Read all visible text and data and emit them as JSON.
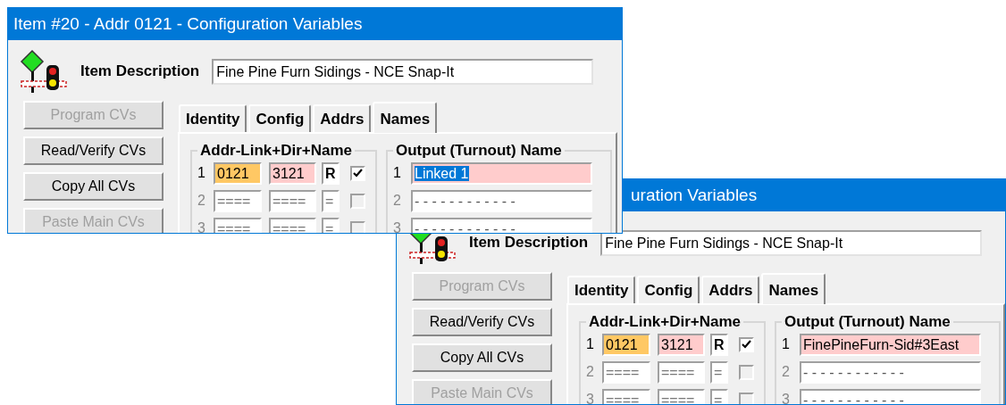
{
  "windows": [
    {
      "title": "Item #20 - Addr 0121 - Configuration Variables",
      "description_label": "Item Description",
      "description": "Fine Pine Furn Sidings - NCE Snap-It",
      "buttons": [
        {
          "label": "Program CVs",
          "disabled": true
        },
        {
          "label": "Read/Verify CVs",
          "disabled": false
        },
        {
          "label": "Copy All CVs",
          "disabled": false
        },
        {
          "label": "Paste Main CVs",
          "disabled": true
        }
      ],
      "tabs": [
        {
          "label": "Identity",
          "selected": false
        },
        {
          "label": "Config",
          "selected": false
        },
        {
          "label": "Addrs",
          "selected": false
        },
        {
          "label": "Names",
          "selected": true
        }
      ],
      "addr_group": {
        "title": "Addr-Link+Dir+Name",
        "rows": [
          {
            "number": "1",
            "addr": "0121",
            "link": "3121",
            "dir": "R",
            "active": true,
            "checked": true
          },
          {
            "number": "2",
            "addr": "====",
            "link": "====",
            "dir": "=",
            "active": false,
            "checked": false
          },
          {
            "number": "3",
            "addr": "====",
            "link": "====",
            "dir": "=",
            "active": false,
            "checked": false
          }
        ]
      },
      "name_group": {
        "title": "Output (Turnout) Name",
        "rows": [
          {
            "number": "1",
            "name": "Linked 1",
            "active": true,
            "text_selected": true
          },
          {
            "number": "2",
            "name": "- - - - - - - - - - - -",
            "active": false,
            "text_selected": false
          },
          {
            "number": "3",
            "name": "- - - - - - - - - - - -",
            "active": false,
            "text_selected": false
          }
        ]
      }
    },
    {
      "title": "uration Variables",
      "description_label": "Item Description",
      "description": "Fine Pine Furn Sidings - NCE Snap-It",
      "buttons": [
        {
          "label": "Program CVs",
          "disabled": true
        },
        {
          "label": "Read/Verify CVs",
          "disabled": false
        },
        {
          "label": "Copy All CVs",
          "disabled": false
        },
        {
          "label": "Paste Main CVs",
          "disabled": true
        }
      ],
      "tabs": [
        {
          "label": "Identity",
          "selected": false
        },
        {
          "label": "Config",
          "selected": false
        },
        {
          "label": "Addrs",
          "selected": false
        },
        {
          "label": "Names",
          "selected": true
        }
      ],
      "addr_group": {
        "title": "Addr-Link+Dir+Name",
        "rows": [
          {
            "number": "1",
            "addr": "0121",
            "link": "3121",
            "dir": "R",
            "active": true,
            "checked": true
          },
          {
            "number": "2",
            "addr": "====",
            "link": "====",
            "dir": "=",
            "active": false,
            "checked": false
          },
          {
            "number": "3",
            "addr": "====",
            "link": "====",
            "dir": "=",
            "active": false,
            "checked": false
          }
        ]
      },
      "name_group": {
        "title": "Output (Turnout) Name",
        "rows": [
          {
            "number": "1",
            "name": "FinePineFurn-Sid#3East",
            "active": true,
            "text_selected": false
          },
          {
            "number": "2",
            "name": "- - - - - - - - - - - -",
            "active": false,
            "text_selected": false
          },
          {
            "number": "3",
            "name": "- - - - - - - - - - - -",
            "active": false,
            "text_selected": false
          }
        ]
      }
    }
  ]
}
